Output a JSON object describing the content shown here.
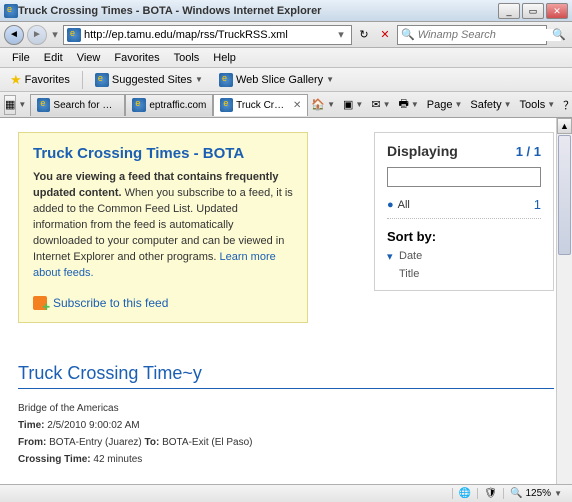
{
  "window": {
    "title": "Truck Crossing Times - BOTA - Windows Internet Explorer"
  },
  "nav": {
    "url": "http://ep.tamu.edu/map/rss/TruckRSS.xml",
    "search_placeholder": "Winamp Search"
  },
  "menu": [
    "File",
    "Edit",
    "View",
    "Favorites",
    "Tools",
    "Help"
  ],
  "favbar": {
    "favorites": "Favorites",
    "suggested": "Suggested Sites",
    "webslice": "Web Slice Gallery"
  },
  "tabs": [
    {
      "label": "Search for En...",
      "active": false
    },
    {
      "label": "eptraffic.com",
      "active": false
    },
    {
      "label": "Truck Cros...",
      "active": true
    }
  ],
  "cmdbar": {
    "page": "Page",
    "safety": "Safety",
    "tools": "Tools"
  },
  "feed_header": {
    "title": "Truck Crossing Times - BOTA",
    "bold": "You are viewing a feed that contains frequently updated content.",
    "body": " When you subscribe to a feed, it is added to the Common Feed List. Updated information from the feed is automatically downloaded to your computer and can be viewed in Internet Explorer and other programs. ",
    "learn": "Learn more about feeds.",
    "subscribe": "Subscribe to this feed"
  },
  "sidebar": {
    "displaying": "Displaying",
    "count": "1 / 1",
    "all": "All",
    "all_count": "1",
    "sortby": "Sort by:",
    "sort": [
      "Date",
      "Title"
    ]
  },
  "item": {
    "title": "Truck Crossing Time~y",
    "loc": "Bridge of the Americas",
    "time_label": "Time:",
    "time": "2/5/2010 9:00:02 AM",
    "from_label": "From:",
    "from": "BOTA-Entry (Juarez)",
    "to_label": "To:",
    "to": "BOTA-Exit (El Paso)",
    "ct_label": "Crossing Time:",
    "ct": "42 minutes"
  },
  "status": {
    "zoom": "125%"
  }
}
